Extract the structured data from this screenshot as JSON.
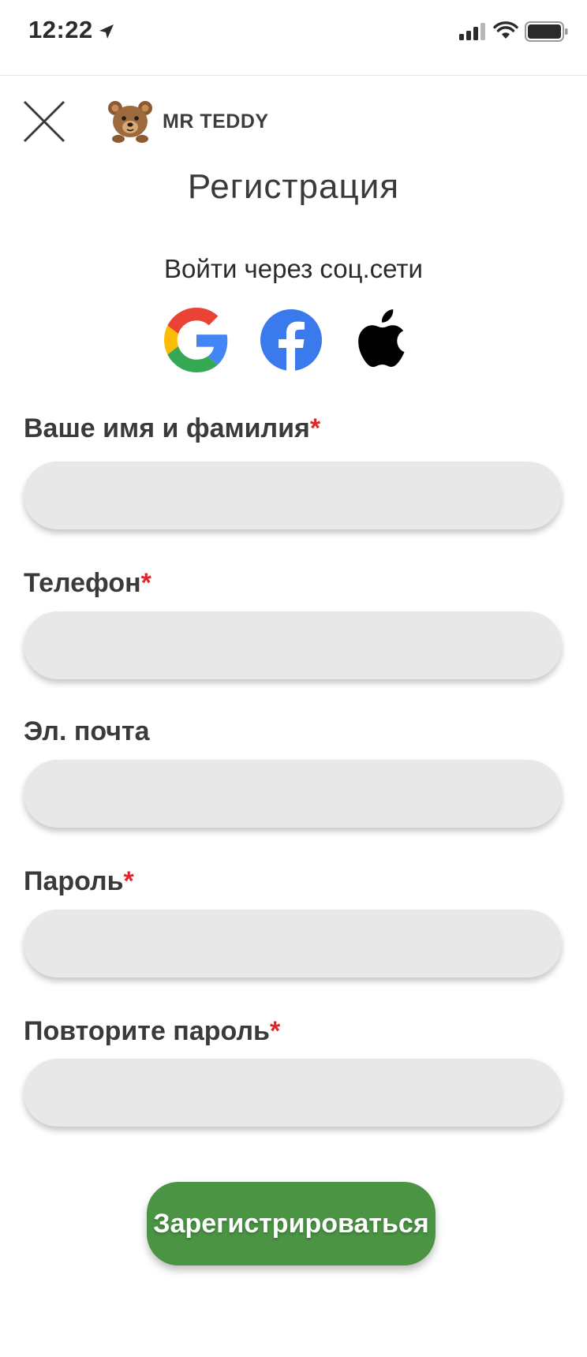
{
  "status_bar": {
    "time": "12:22",
    "icons": [
      "location-arrow-icon",
      "cellular-signal-icon",
      "wifi-icon",
      "battery-icon"
    ]
  },
  "header": {
    "close_icon": "close-icon",
    "brand_name": "MR TEDDY",
    "brand_logo": "teddy-bear-logo"
  },
  "page": {
    "title": "Регистрация"
  },
  "social": {
    "heading": "Войти через соц.сети",
    "providers": [
      {
        "icon": "google-icon"
      },
      {
        "icon": "facebook-icon"
      },
      {
        "icon": "apple-icon"
      }
    ]
  },
  "form": {
    "required_mark": "*",
    "fields": [
      {
        "label": "Ваше имя и фамилия",
        "required": true,
        "value": "",
        "placeholder": ""
      },
      {
        "label": "Телефон",
        "required": true,
        "value": "",
        "placeholder": ""
      },
      {
        "label": "Эл. почта",
        "required": false,
        "value": "",
        "placeholder": ""
      },
      {
        "label": "Пароль",
        "required": true,
        "value": "",
        "placeholder": ""
      },
      {
        "label": "Повторите пароль",
        "required": true,
        "value": "",
        "placeholder": ""
      }
    ],
    "submit_label": "Зарегистрироваться"
  },
  "colors": {
    "accent_green": "#4a9444",
    "required_red": "#e0262b",
    "input_bg": "#e8e8e8",
    "facebook_blue": "#3b7aed"
  }
}
